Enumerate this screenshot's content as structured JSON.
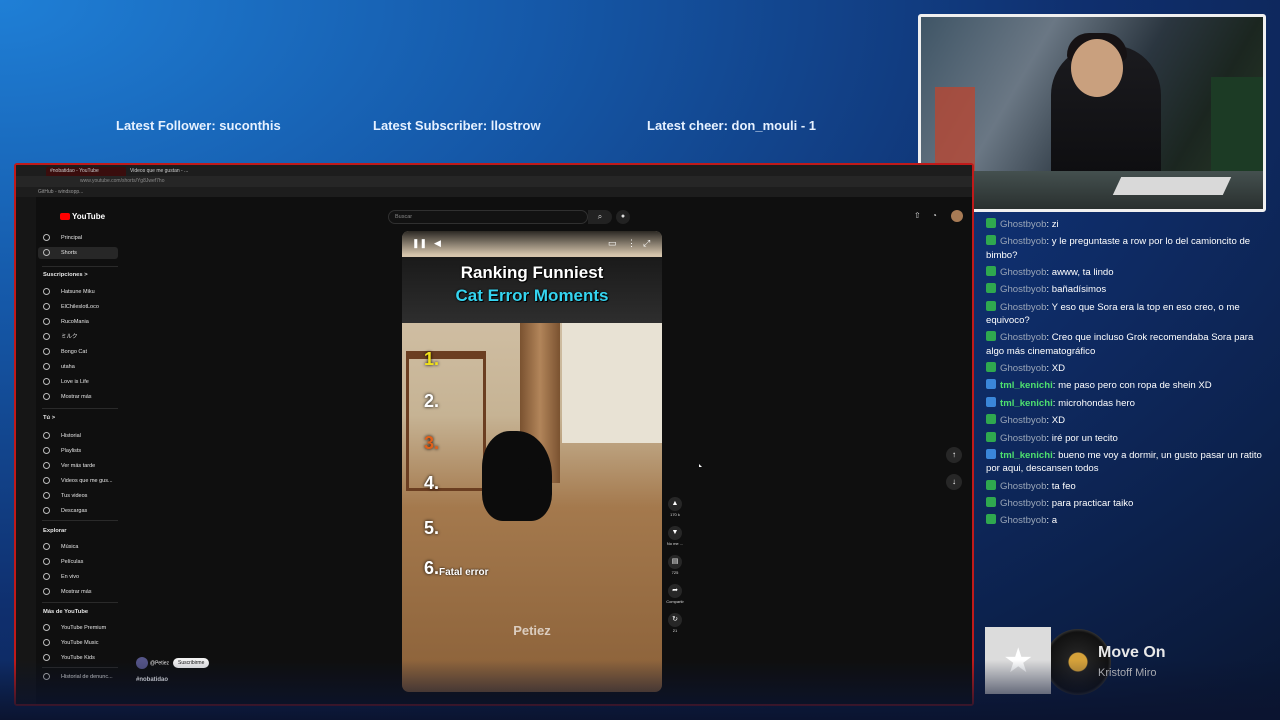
{
  "overlay": {
    "latest_follower": "Latest Follower: suconthis",
    "latest_subscriber": "Latest Subscriber: llostrow",
    "latest_cheer": "Latest cheer: don_mouli - 1"
  },
  "chat": [
    {
      "badge": "green",
      "user": "Ghostbyob",
      "text": "zi"
    },
    {
      "badge": "green",
      "user": "Ghostbyob",
      "text": "y le preguntaste a row por lo del camioncito de bimbo?"
    },
    {
      "badge": "green",
      "user": "Ghostbyob",
      "text": "awww, ta lindo"
    },
    {
      "badge": "green",
      "user": "Ghostbyob",
      "text": "bañadísimos"
    },
    {
      "badge": "green",
      "user": "Ghostbyob",
      "text": "Y eso que Sora era la top en eso creo, o me equivoco?"
    },
    {
      "badge": "green",
      "user": "Ghostbyob",
      "text": "Creo que incluso Grok recomendaba Sora para algo más cinematográfico"
    },
    {
      "badge": "green",
      "user": "Ghostbyob",
      "text": "XD"
    },
    {
      "badge": "blue",
      "user": "tml_kenichi",
      "text": "me paso pero con ropa de shein XD"
    },
    {
      "badge": "blue",
      "user": "tml_kenichi",
      "text": "microhondas hero"
    },
    {
      "badge": "green",
      "user": "Ghostbyob",
      "text": "XD"
    },
    {
      "badge": "green",
      "user": "Ghostbyob",
      "text": "iré por un tecito"
    },
    {
      "badge": "blue",
      "user": "tml_kenichi",
      "text": "bueno me voy a dormir, un gusto pasar un ratito por aqui, descansen todos"
    },
    {
      "badge": "green",
      "user": "Ghostbyob",
      "text": "ta feo"
    },
    {
      "badge": "green",
      "user": "Ghostbyob",
      "text": "para practicar taiko"
    },
    {
      "badge": "green",
      "user": "Ghostbyob",
      "text": "a"
    }
  ],
  "now_playing": {
    "song": "Move On",
    "artist": "Kristoff Miro"
  },
  "browser": {
    "tab_active": "#nobatidao - YouTube",
    "tab_other": "Videos que me gustan - ...",
    "url": "www.youtube.com/shorts/Yg8Jwef7ho",
    "bookmark": "GitHub - windsopp..."
  },
  "youtube": {
    "logo": "YouTube",
    "search_placeholder": "Buscar",
    "sidebar": {
      "main": [
        {
          "label": "Principal",
          "icon": "home-icon"
        },
        {
          "label": "Shorts",
          "icon": "shorts-icon"
        }
      ],
      "subs_header": "Suscripciones  >",
      "subs": [
        {
          "label": "Hatsune Miku"
        },
        {
          "label": "ElChileslotLoco"
        },
        {
          "label": "RucoMania"
        },
        {
          "label": "ミルク"
        },
        {
          "label": "Bongo Cat"
        },
        {
          "label": "utaha"
        },
        {
          "label": "Love is Life"
        },
        {
          "label": "Mostrar más"
        }
      ],
      "you_header": "Tú  >",
      "you": [
        {
          "label": "Historial"
        },
        {
          "label": "Playlists"
        },
        {
          "label": "Ver más tarde"
        },
        {
          "label": "Videos que me gus..."
        },
        {
          "label": "Tus videos"
        },
        {
          "label": "Descargas"
        }
      ],
      "explore_header": "Explorar",
      "explore": [
        {
          "label": "Música"
        },
        {
          "label": "Películas"
        },
        {
          "label": "En vivo"
        },
        {
          "label": "Mostrar más"
        }
      ],
      "more_header": "Más de YouTube",
      "more": [
        {
          "label": "YouTube Premium"
        },
        {
          "label": "YouTube Music"
        },
        {
          "label": "YouTube Kids"
        }
      ],
      "report": "Historial de denunc..."
    },
    "short": {
      "title_line1": "Ranking Funniest",
      "title_line2": "Cat Error Moments",
      "ranks": [
        {
          "n": "1.",
          "color": "#f2e21a"
        },
        {
          "n": "2.",
          "color": "#ffffff"
        },
        {
          "n": "3.",
          "color": "#e0601a"
        },
        {
          "n": "4.",
          "color": "#ffffff"
        },
        {
          "n": "5.",
          "color": "#ffffff"
        },
        {
          "n": "6.",
          "color": "#ffffff"
        }
      ],
      "fatal": "Fatal error",
      "watermark": "Petiez",
      "likes": "170 k",
      "dislike": "No me ...",
      "comments": "725",
      "share": "Compartir",
      "remix": "21"
    },
    "channel": "@Petiez",
    "subscribe": "Suscribirme",
    "hashtag": "#nobatidao"
  }
}
